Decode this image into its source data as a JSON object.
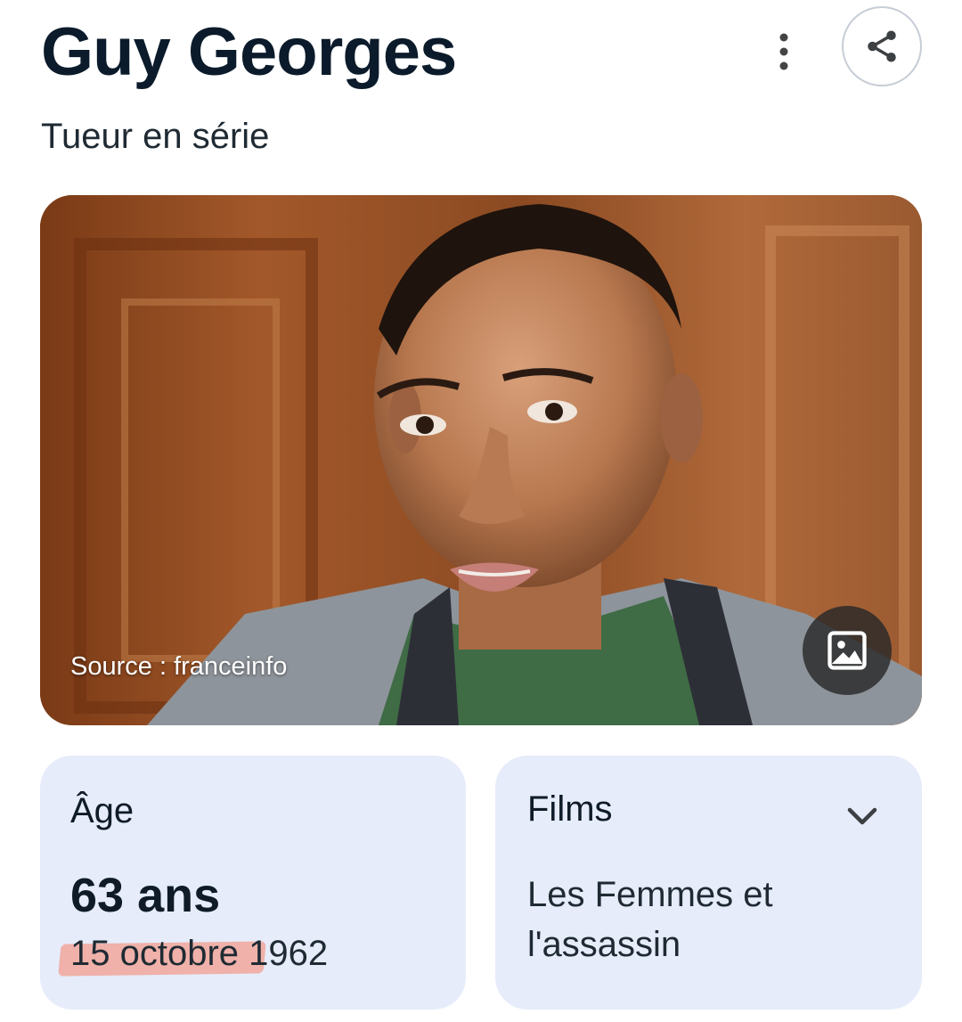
{
  "header": {
    "title": "Guy Georges",
    "subtitle": "Tueur en série",
    "more_icon": "more-vert-icon",
    "share_icon": "share-icon"
  },
  "photo": {
    "source": "Source : franceinfo",
    "image_icon": "image-icon"
  },
  "cards": {
    "age": {
      "label": "Âge",
      "value": "63 ans",
      "birth_day_month": "15 octobre",
      "birth_year": " 1962"
    },
    "films": {
      "label": "Films",
      "title": "Les Femmes et l'assassin",
      "chevron_icon": "chevron-down-icon"
    }
  },
  "colors": {
    "card_bg": "#e6ecfa",
    "title": "#0b1b2b",
    "highlight": "#f0a79a"
  }
}
